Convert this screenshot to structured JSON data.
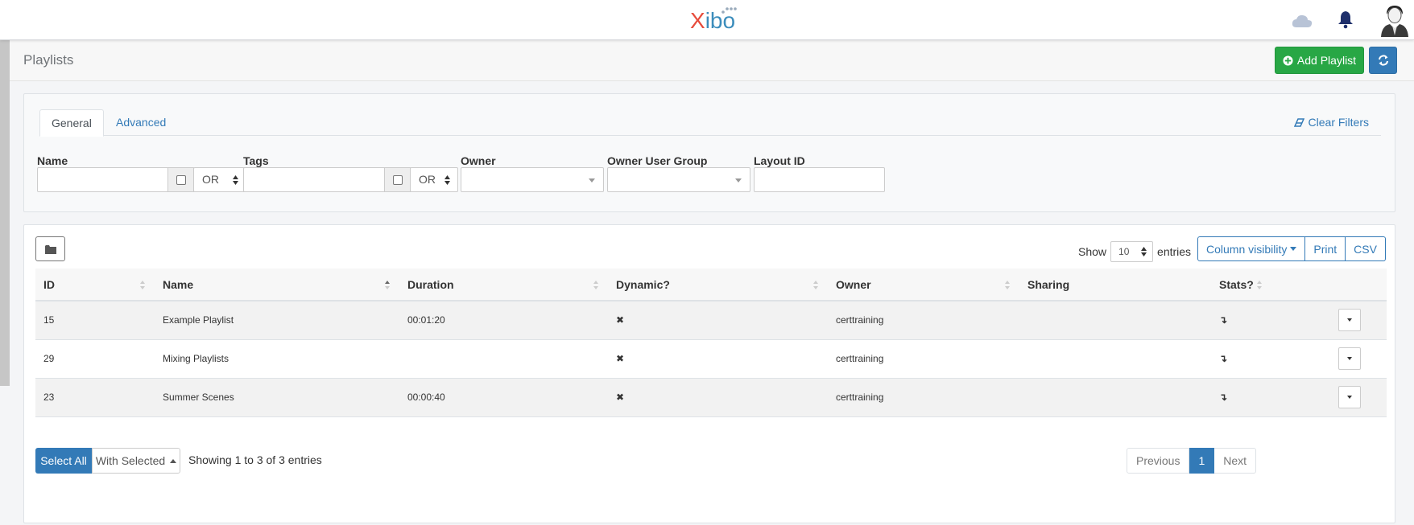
{
  "brand": {
    "logo_x": "X",
    "logo_rest": "ibo"
  },
  "header": {
    "title": "Playlists",
    "add_button_label": "Add Playlist"
  },
  "filters": {
    "tabs": [
      {
        "label": "General",
        "active": true
      },
      {
        "label": "Advanced",
        "active": false
      }
    ],
    "clear_label": "Clear Filters",
    "fields": {
      "name_label": "Name",
      "name_operator": "OR",
      "tags_label": "Tags",
      "tags_operator": "OR",
      "owner_label": "Owner",
      "owner_group_label": "Owner User Group",
      "layout_id_label": "Layout ID"
    }
  },
  "table": {
    "show_label": "Show",
    "page_length": "10",
    "entries_label": "entries",
    "buttons": {
      "column_visibility": "Column visibility",
      "print": "Print",
      "csv": "CSV"
    },
    "columns": [
      "ID",
      "Name",
      "Duration",
      "Dynamic?",
      "Owner",
      "Sharing",
      "Stats?"
    ],
    "rows": [
      {
        "id": "15",
        "name": "Example Playlist",
        "duration": "00:01:20",
        "dynamic": "✖",
        "owner": "certtraining",
        "sharing": "",
        "stats": "↴"
      },
      {
        "id": "29",
        "name": "Mixing Playlists",
        "duration": "",
        "dynamic": "✖",
        "owner": "certtraining",
        "sharing": "",
        "stats": "↴"
      },
      {
        "id": "23",
        "name": "Summer Scenes",
        "duration": "00:00:40",
        "dynamic": "✖",
        "owner": "certtraining",
        "sharing": "",
        "stats": "↴"
      }
    ],
    "select_all_label": "Select All",
    "with_selected_label": "With Selected",
    "info_text": "Showing 1 to 3 of 3 entries",
    "pagination": {
      "previous": "Previous",
      "current": "1",
      "next": "Next"
    }
  },
  "icons": {
    "cloud": "cloud-icon",
    "bell": "bell-icon",
    "avatar": "avatar",
    "folder": "folder-icon",
    "refresh": "refresh-icon",
    "eraser": "eraser-icon",
    "plus_circle": "plus-circle-icon"
  },
  "colors": {
    "primary": "#337ab7",
    "success": "#28a745",
    "logo_red": "#e74c3c",
    "logo_blue": "#3c8dbc"
  }
}
